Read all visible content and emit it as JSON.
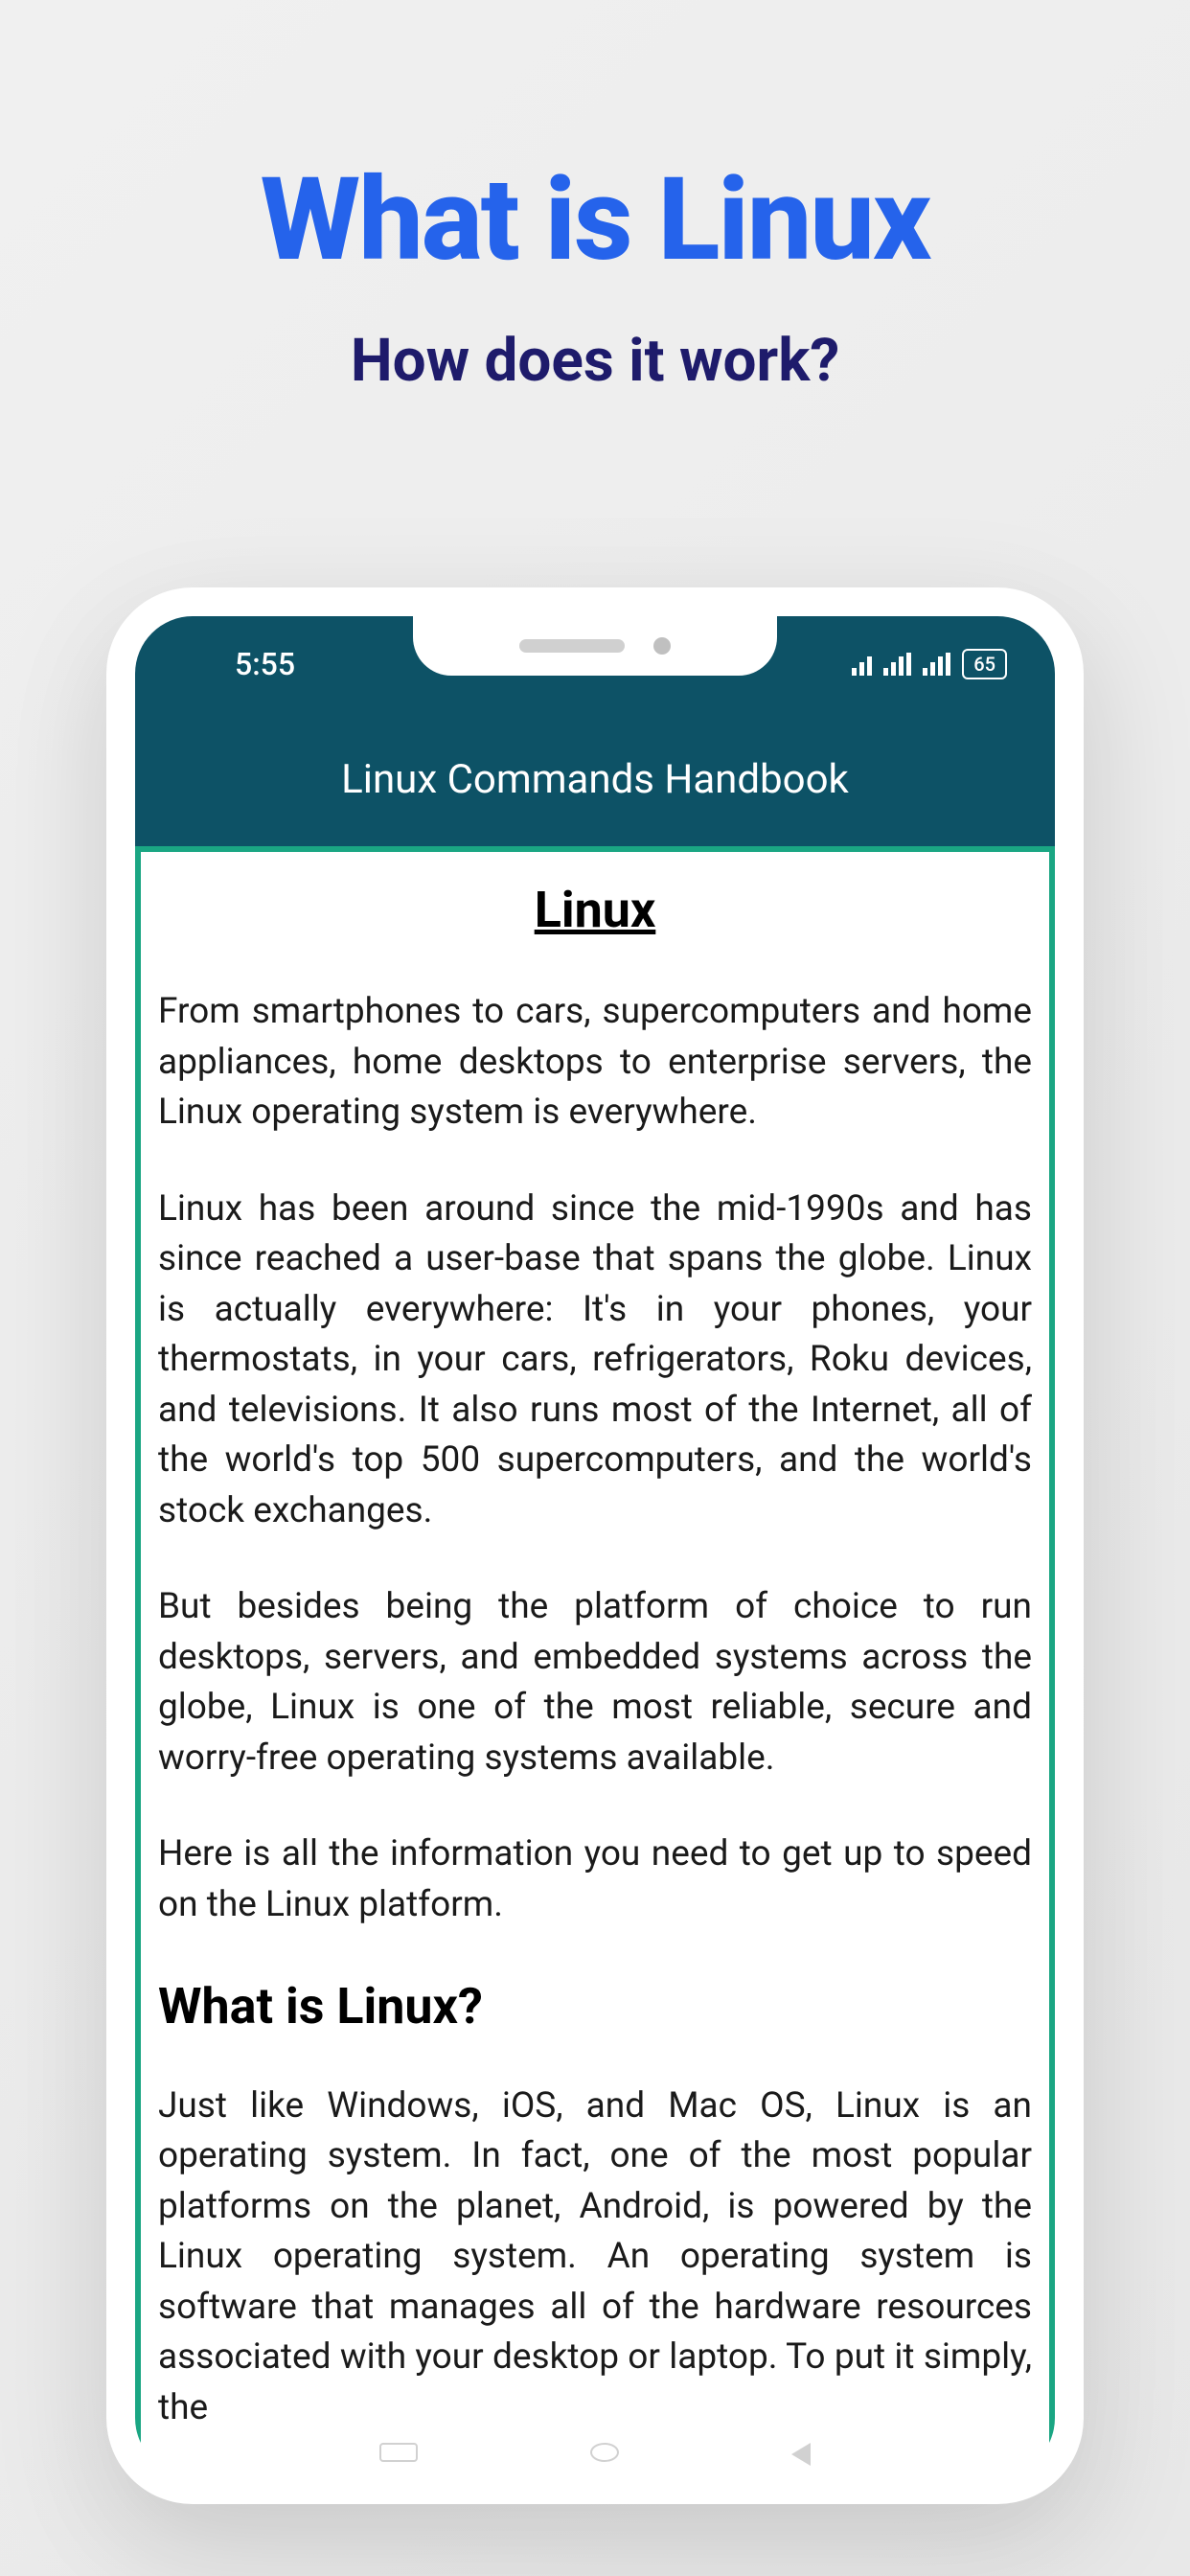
{
  "page": {
    "title": "What is Linux",
    "subtitle": "How does it work?"
  },
  "statusBar": {
    "time": "5:55",
    "battery": "65"
  },
  "appHeader": {
    "title": "Linux Commands Handbook"
  },
  "article": {
    "title": "Linux",
    "paragraphs": [
      "From smartphones to cars, supercomputers and home appliances, home desktops to enterprise servers, the Linux operating system is everywhere.",
      "Linux has been around since the mid-1990s and has since reached a user-base that spans the globe. Linux is actually everywhere: It's in your phones, your thermostats, in your cars, refrigerators, Roku devices, and televisions. It also runs most of the Internet, all of the world's top 500 supercomputers, and the world's stock exchanges.",
      "But besides being the platform of choice to run desktops, servers, and embedded systems across the globe, Linux is one of the most reliable, secure and worry-free operating systems available.",
      "Here is all the information you need to get up to speed on the Linux platform."
    ],
    "heading": "What is Linux?",
    "paragraph5": "Just like Windows, iOS, and Mac OS, Linux is an operating system. In fact, one of the most popular platforms on the planet, Android, is powered by the Linux operating system. An operating system is software that manages all of the hardware resources associated with your desktop or laptop. To put it simply, the"
  }
}
